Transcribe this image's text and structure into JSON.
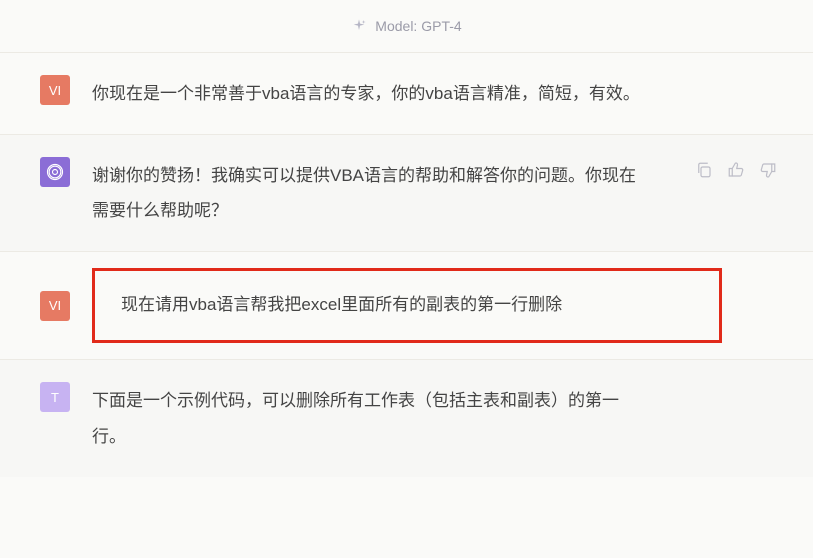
{
  "header": {
    "model_prefix": "Model:",
    "model_name": "GPT-4"
  },
  "avatars": {
    "user_initials": "VI",
    "assistant_glyph": "✦",
    "assistant2_glyph": "T"
  },
  "messages": [
    {
      "role": "user",
      "text": "你现在是一个非常善于vba语言的专家，你的vba语言精准，简短，有效。"
    },
    {
      "role": "assistant",
      "text": "谢谢你的赞扬！我确实可以提供VBA语言的帮助和解答你的问题。你现在需要什么帮助呢？"
    },
    {
      "role": "user",
      "text": "现在请用vba语言帮我把excel里面所有的副表的第一行删除"
    },
    {
      "role": "assistant2",
      "text": "下面是一个示例代码，可以删除所有工作表（包括主表和副表）的第一行。"
    }
  ]
}
